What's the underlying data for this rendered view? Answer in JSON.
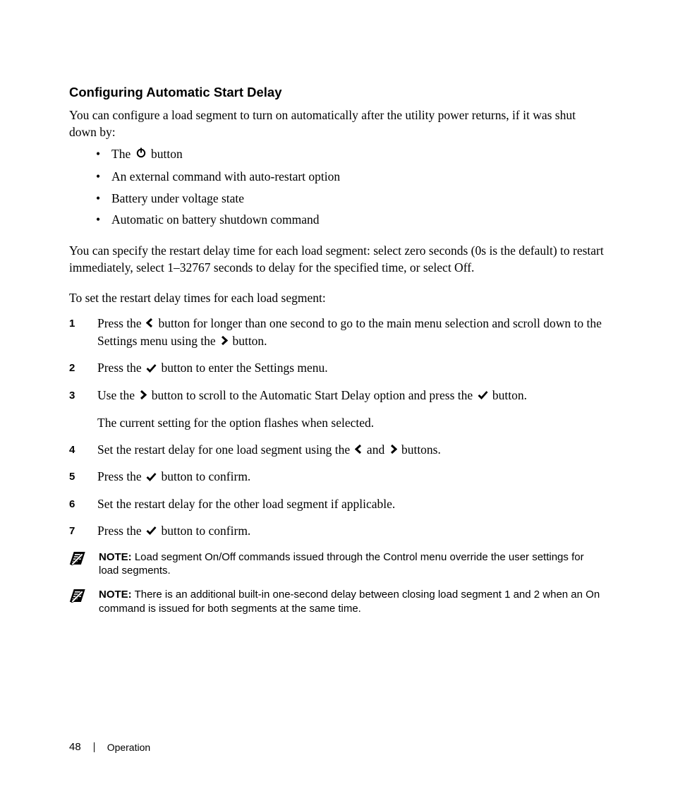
{
  "heading": "Configuring Automatic Start Delay",
  "intro": "You can configure a load segment to turn on automatically after the utility power returns, if it was shut down by:",
  "bullets": {
    "b1_pre": "The ",
    "b1_post": " button",
    "b2": "An external command with auto-restart option",
    "b3": "Battery under voltage state",
    "b4": "Automatic on battery shutdown command"
  },
  "para2": "You can specify the restart delay time for each load segment: select zero seconds (0s is the default) to restart immediately, select 1–32767 seconds to delay for the specified time, or select Off.",
  "para3": "To set the restart delay times for each load segment:",
  "steps": {
    "s1": {
      "num": "1",
      "pre": "Press the ",
      "mid": " button for longer than one second to go to the main menu selection and scroll down to the Settings menu using the ",
      "post": " button."
    },
    "s2": {
      "num": "2",
      "pre": "Press the ",
      "post": " button to enter the Settings menu."
    },
    "s3": {
      "num": "3",
      "pre": "Use the ",
      "mid": " button to scroll to the Automatic Start Delay option and press the ",
      "post": " button.",
      "sub": "The current setting for the option flashes when selected."
    },
    "s4": {
      "num": "4",
      "pre": "Set the restart delay for one load segment using the ",
      "mid": " and ",
      "post": " buttons."
    },
    "s5": {
      "num": "5",
      "pre": "Press the ",
      "post": " button to confirm."
    },
    "s6": {
      "num": "6",
      "text": "Set the restart delay for the other load segment if applicable."
    },
    "s7": {
      "num": "7",
      "pre": "Press the ",
      "post": " button to confirm."
    }
  },
  "notes": {
    "label": "NOTE:",
    "n1": " Load segment On/Off commands issued through the Control menu override the user settings for load segments.",
    "n2": " There is an additional built-in one-second delay between closing load segment 1 and 2 when an On command is issued for both segments at the same time."
  },
  "footer": {
    "page": "48",
    "chapter": "Operation"
  }
}
